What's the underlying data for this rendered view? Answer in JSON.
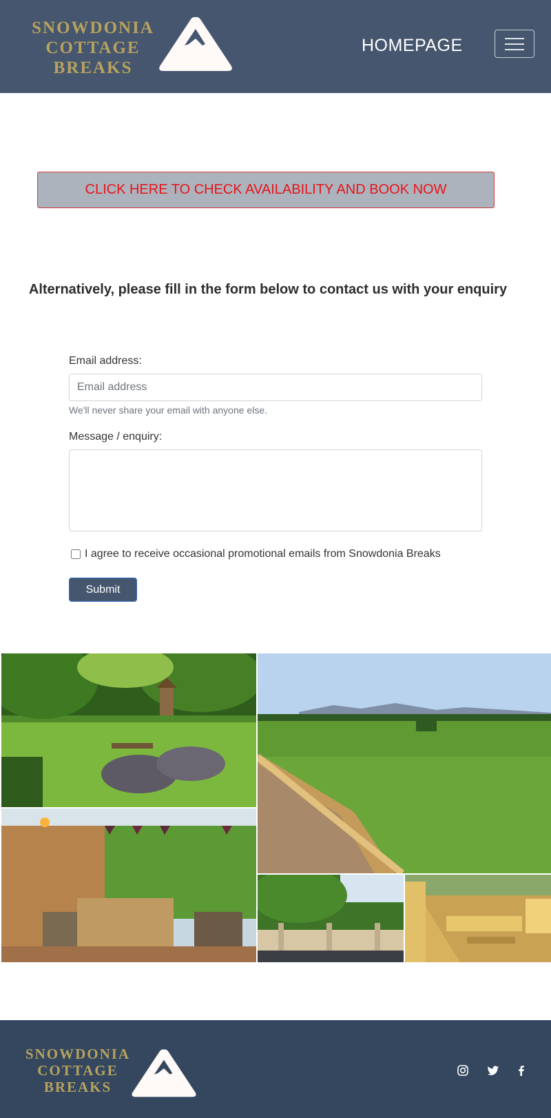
{
  "header": {
    "brand_lines": [
      "SNOWDONIA",
      "COTTAGE",
      "BREAKS"
    ],
    "nav_link": "HOMEPAGE",
    "menu_icon": "hamburger-icon"
  },
  "book_button": "CLICK HERE TO CHECK AVAILABILITY AND BOOK NOW",
  "enquiry_heading": "Alternatively, please fill in the form below to contact us with your enquiry",
  "form": {
    "email_label": "Email address:",
    "email_placeholder": "Email address",
    "email_help": "We'll never share your email with anyone else.",
    "message_label": "Message / enquiry:",
    "consent_label": "I agree to receive occasional promotional emails from Snowdonia Breaks",
    "submit_label": "Submit"
  },
  "footer": {
    "brand_lines": [
      "SNOWDONIA",
      "COTTAGE",
      "BREAKS"
    ],
    "social_icons": [
      "instagram-icon",
      "twitter-icon",
      "facebook-icon"
    ]
  },
  "colors": {
    "header_bg": "#46566f",
    "footer_bg": "#34475f",
    "brand_gold": "#b7a35d",
    "book_text": "#e8131a"
  }
}
